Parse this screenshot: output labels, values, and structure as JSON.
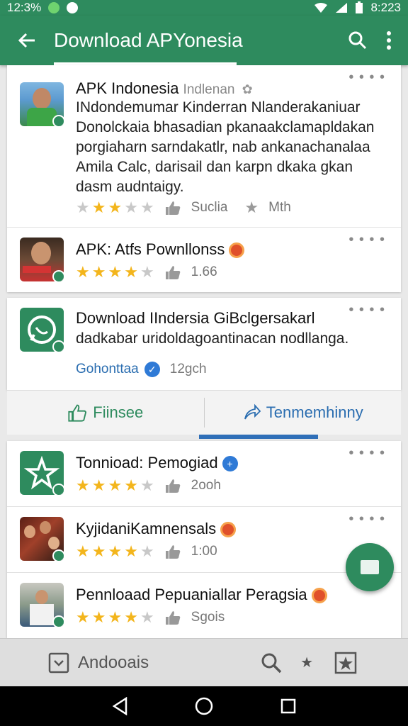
{
  "status": {
    "left_text": "12:3%",
    "time": "8:223"
  },
  "appbar": {
    "title": "Download APYonesia"
  },
  "items": [
    {
      "title": "APK Indonesia",
      "subtitle": "Indlenan",
      "description": "INdondemumar Kinderran Nlanderakaniuar Donolckaia bhasadian pkanaakclamapldakan porgiaharn sarndakatlr, nab ankanachanalaa Amila Calc, darisail dan karpn dkaka gkan dasm audntaigy.",
      "rating": 2.5,
      "meta1": "Suclia",
      "meta2": "Mth"
    },
    {
      "title": "APK: Atfs Pownllonss",
      "rating": 3.5,
      "meta1": "1.66"
    },
    {
      "title": "Download IIndersia GiBclgersakarl",
      "description": "dadkabar uridoldagoantinacan nodllanga.",
      "developer": "Gohonttaa",
      "meta1": "12gch"
    }
  ],
  "actions": {
    "left": "Fiinsee",
    "right": "Tenmemhinny"
  },
  "list2": [
    {
      "title": "Tonnioad: Pemogiad",
      "rating": 3.5,
      "meta": "2ooh"
    },
    {
      "title": "KyjidaniKamnensals",
      "rating": 3.5,
      "meta": "1:00"
    },
    {
      "title": "Pennloaad Pepuaniallar Peragsia",
      "rating": 3.5,
      "meta": "Sgois"
    }
  ],
  "bottom": {
    "label": "Andooais"
  },
  "colors": {
    "primary": "#2e8b5e",
    "accent": "#2f6fb8",
    "star": "#f3b51c"
  },
  "icons": {
    "back": "arrow-left-icon",
    "search": "search-icon",
    "more": "more-vert-icon"
  }
}
